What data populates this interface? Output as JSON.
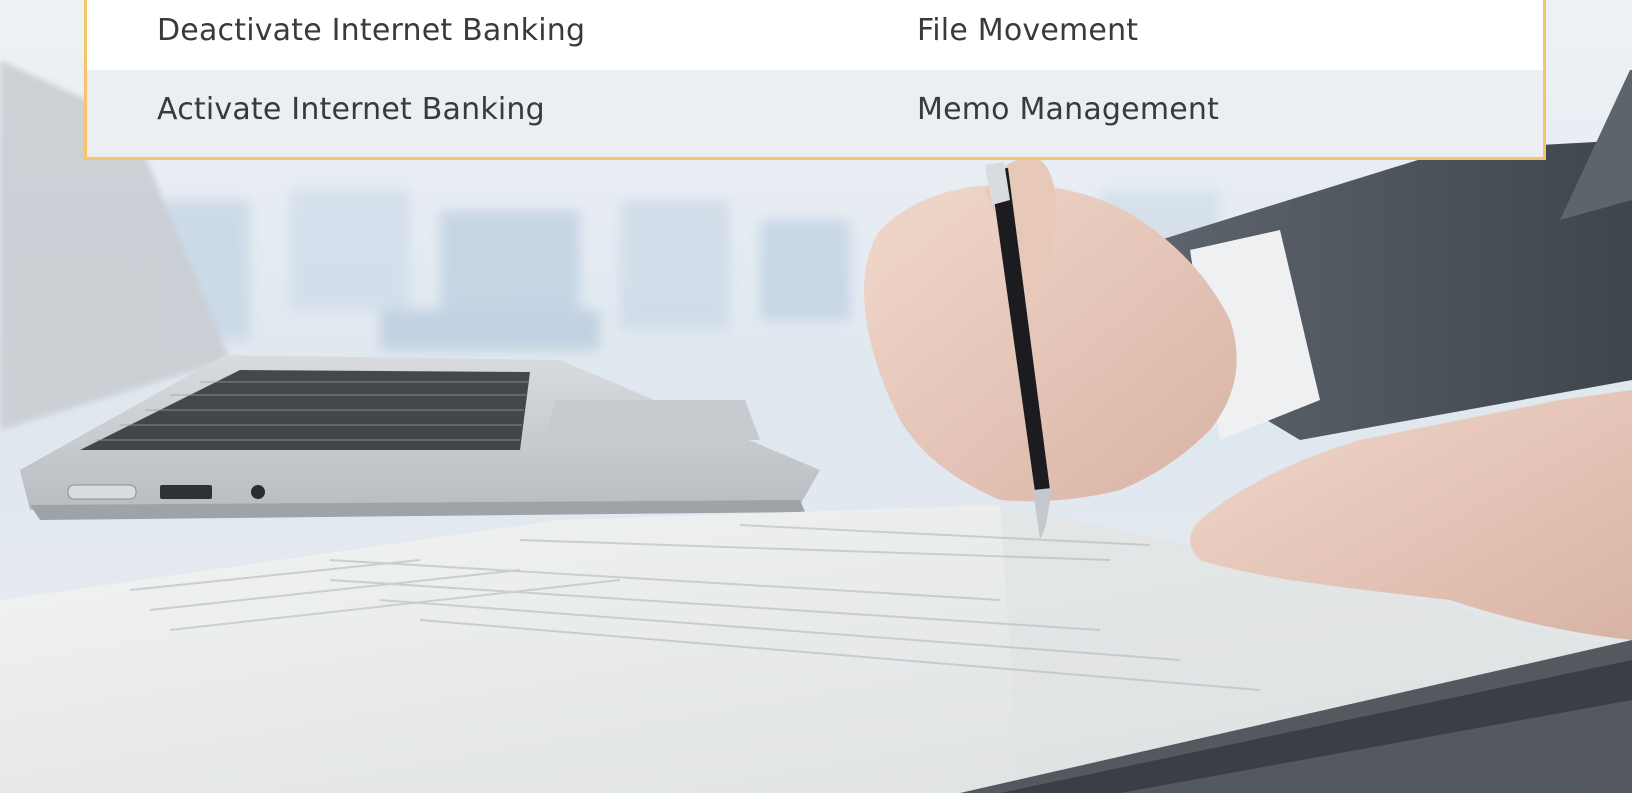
{
  "menu": {
    "rows": [
      {
        "left": "Deactivate Internet Banking",
        "right": "File Movement"
      },
      {
        "left": "Activate Internet Banking",
        "right": "Memo Management"
      }
    ]
  },
  "colors": {
    "panel_border": "#f6c56b",
    "row_alt": "#eceff1",
    "text": "#3a3a3a"
  }
}
